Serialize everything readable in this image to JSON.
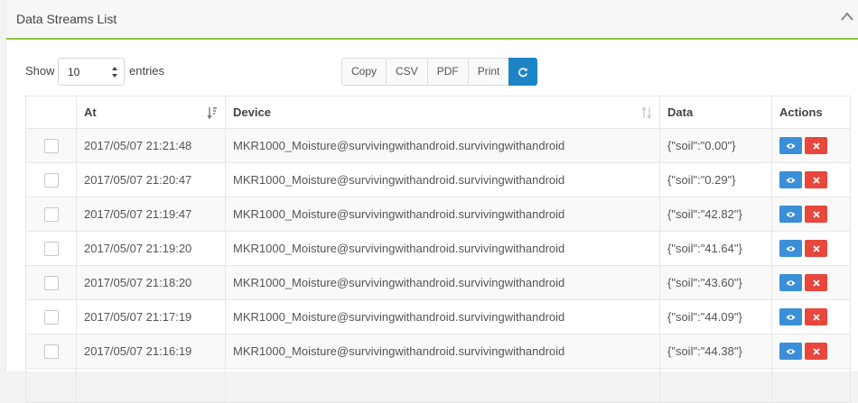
{
  "panel": {
    "title": "Data Streams List"
  },
  "controls": {
    "show_label": "Show",
    "length_value": "10",
    "entries_label": "entries",
    "buttons": [
      "Copy",
      "CSV",
      "PDF",
      "Print"
    ]
  },
  "table": {
    "columns": {
      "at": "At",
      "device": "Device",
      "data": "Data",
      "actions": "Actions"
    },
    "rows": [
      {
        "at": "2017/05/07 21:21:48",
        "device": "MKR1000_Moisture@survivingwithandroid.survivingwithandroid",
        "data": "{\"soil\":\"0.00\"}"
      },
      {
        "at": "2017/05/07 21:20:47",
        "device": "MKR1000_Moisture@survivingwithandroid.survivingwithandroid",
        "data": "{\"soil\":\"0.29\"}"
      },
      {
        "at": "2017/05/07 21:19:47",
        "device": "MKR1000_Moisture@survivingwithandroid.survivingwithandroid",
        "data": "{\"soil\":\"42.82\"}"
      },
      {
        "at": "2017/05/07 21:19:20",
        "device": "MKR1000_Moisture@survivingwithandroid.survivingwithandroid",
        "data": "{\"soil\":\"41.64\"}"
      },
      {
        "at": "2017/05/07 21:18:20",
        "device": "MKR1000_Moisture@survivingwithandroid.survivingwithandroid",
        "data": "{\"soil\":\"43.60\"}"
      },
      {
        "at": "2017/05/07 21:17:19",
        "device": "MKR1000_Moisture@survivingwithandroid.survivingwithandroid",
        "data": "{\"soil\":\"44.09\"}"
      },
      {
        "at": "2017/05/07 21:16:19",
        "device": "MKR1000_Moisture@survivingwithandroid.survivingwithandroid",
        "data": "{\"soil\":\"44.38\"}"
      },
      {
        "at": "",
        "device": "",
        "data": ""
      }
    ]
  },
  "icons": {
    "collapse": "chevron-up-icon",
    "refresh": "refresh-icon",
    "view": "eye-icon",
    "delete": "close-icon"
  },
  "colors": {
    "accent_green": "#8cc63f",
    "primary_blue": "#1c84c6",
    "view_blue": "#3a8fd8",
    "delete_red": "#e9463c"
  }
}
